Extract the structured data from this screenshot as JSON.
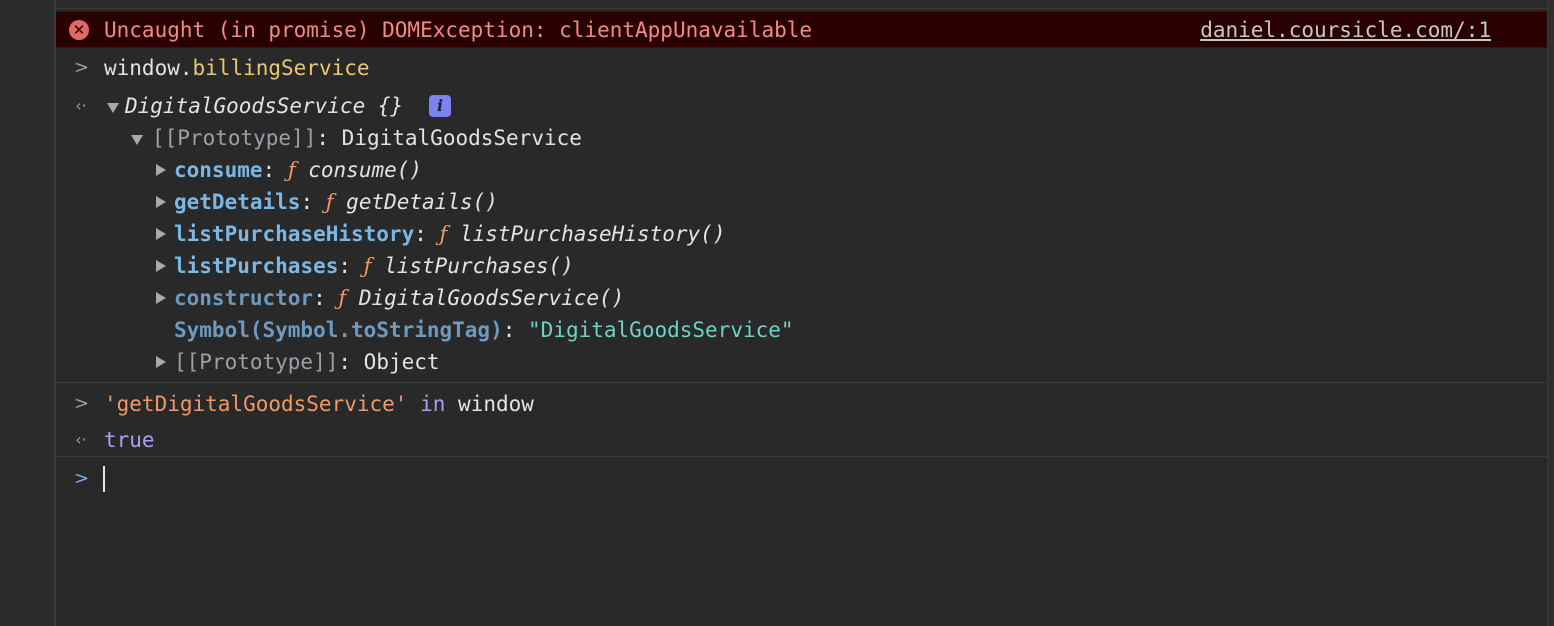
{
  "error": {
    "message": "Uncaught (in promise) DOMException: clientAppUnavailable",
    "source_link": "daniel.coursicle.com/:1"
  },
  "entries": {
    "input1": {
      "object": "window",
      "dot": ".",
      "member": "billingService"
    },
    "result1": {
      "class_name": "DigitalGoodsService",
      "braces": " {}",
      "info_badge": "i",
      "proto_label": "[[Prototype]]",
      "proto_value": "DigitalGoodsService",
      "methods": [
        {
          "name": "consume",
          "fn": "consume()"
        },
        {
          "name": "getDetails",
          "fn": "getDetails()"
        },
        {
          "name": "listPurchaseHistory",
          "fn": "listPurchaseHistory()"
        },
        {
          "name": "listPurchases",
          "fn": "listPurchases()"
        },
        {
          "name": "constructor",
          "fn": "DigitalGoodsService()"
        }
      ],
      "f_symbol": "ƒ",
      "colon": ": ",
      "symbol_key": "Symbol(Symbol.toStringTag)",
      "symbol_value": "\"DigitalGoodsService\"",
      "inner_proto_label": "[[Prototype]]",
      "inner_proto_value": "Object"
    },
    "input2": {
      "string": "'getDigitalGoodsService'",
      "keyword": "in",
      "object": "window"
    },
    "result2": {
      "value": "true"
    }
  },
  "prompts": {
    "input": ">",
    "output": "‹·",
    "active": ">"
  },
  "colors": {
    "error_bg": "#290000",
    "error_text": "#f28b82",
    "property": "#79b8e6",
    "function_marker": "#f29766",
    "string_literal": "#f29766",
    "string_value": "#6bd3c8",
    "keyword": "#a7a0f5",
    "info_badge": "#7c83f0"
  }
}
